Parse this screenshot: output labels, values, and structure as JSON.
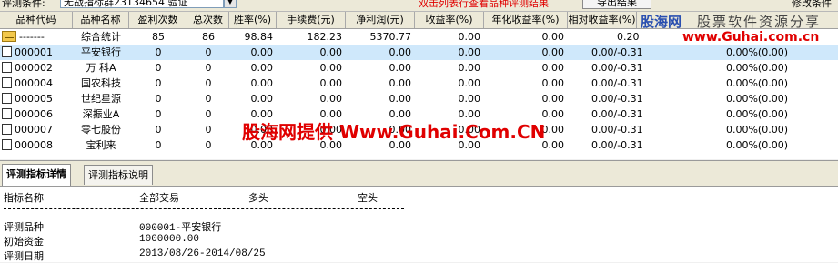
{
  "toolbar": {
    "label": "评测条件:",
    "combo_value": "无战指标群23134654 验证",
    "hint": "双击列表行查看品种评测结果",
    "button_label": "导出结果",
    "right_text": "修改条件"
  },
  "grid": {
    "columns": [
      "品种代码",
      "品种名称",
      "盈利次数",
      "总次数",
      "胜率(%)",
      "手续费(元)",
      "净利润(元)",
      "收益率(%)",
      "年化收益率(%)",
      "相对收益率(%)"
    ],
    "rows": [
      {
        "code": "-------",
        "name": "综合统计",
        "wins": "85",
        "total": "86",
        "rate": "98.84",
        "fee": "182.23",
        "profit": "5370.77",
        "ret": "0.00",
        "annual": "0.00",
        "relative": "0.20",
        "extra": ""
      },
      {
        "code": "000001",
        "name": "平安银行",
        "wins": "0",
        "total": "0",
        "rate": "0.00",
        "fee": "0.00",
        "profit": "0.00",
        "ret": "0.00",
        "annual": "0.00",
        "relative": "0.00/-0.31",
        "extra": "0.00%(0.00)"
      },
      {
        "code": "000002",
        "name": "万  科A",
        "wins": "0",
        "total": "0",
        "rate": "0.00",
        "fee": "0.00",
        "profit": "0.00",
        "ret": "0.00",
        "annual": "0.00",
        "relative": "0.00/-0.31",
        "extra": "0.00%(0.00)"
      },
      {
        "code": "000004",
        "name": "国农科技",
        "wins": "0",
        "total": "0",
        "rate": "0.00",
        "fee": "0.00",
        "profit": "0.00",
        "ret": "0.00",
        "annual": "0.00",
        "relative": "0.00/-0.31",
        "extra": "0.00%(0.00)"
      },
      {
        "code": "000005",
        "name": "世纪星源",
        "wins": "0",
        "total": "0",
        "rate": "0.00",
        "fee": "0.00",
        "profit": "0.00",
        "ret": "0.00",
        "annual": "0.00",
        "relative": "0.00/-0.31",
        "extra": "0.00%(0.00)"
      },
      {
        "code": "000006",
        "name": "深振业A",
        "wins": "0",
        "total": "0",
        "rate": "0.00",
        "fee": "0.00",
        "profit": "0.00",
        "ret": "0.00",
        "annual": "0.00",
        "relative": "0.00/-0.31",
        "extra": "0.00%(0.00)"
      },
      {
        "code": "000007",
        "name": "零七股份",
        "wins": "0",
        "total": "0",
        "rate": "0.00",
        "fee": "0.00",
        "profit": "0.00",
        "ret": "0.00",
        "annual": "0.00",
        "relative": "0.00/-0.31",
        "extra": "0.00%(0.00)"
      },
      {
        "code": "000008",
        "name": "宝利来",
        "wins": "0",
        "total": "0",
        "rate": "0.00",
        "fee": "0.00",
        "profit": "0.00",
        "ret": "0.00",
        "annual": "0.00",
        "relative": "0.00/-0.31",
        "extra": "0.00%(0.00)"
      }
    ]
  },
  "watermark": {
    "logo_brand": "股海网",
    "logo_slogan": "股票软件资源分享",
    "logo_url": "www.Guhai.com.cn",
    "center_text": "股海网提供 Www.Guhai.Com.CN"
  },
  "tabs": [
    {
      "label": "评测指标详情",
      "active": true
    },
    {
      "label": "评测指标说明",
      "active": false
    }
  ],
  "detail": {
    "header": {
      "col1": "指标名称",
      "col2": "全部交易",
      "col3": "多头",
      "col4": "空头"
    },
    "lines": [
      {
        "label": "评测品种",
        "value": "000001-平安银行"
      },
      {
        "label": "初始资金",
        "value": "1000000.00"
      },
      {
        "label": "评测日期",
        "value": "2013/08/26-2014/08/25"
      }
    ]
  }
}
